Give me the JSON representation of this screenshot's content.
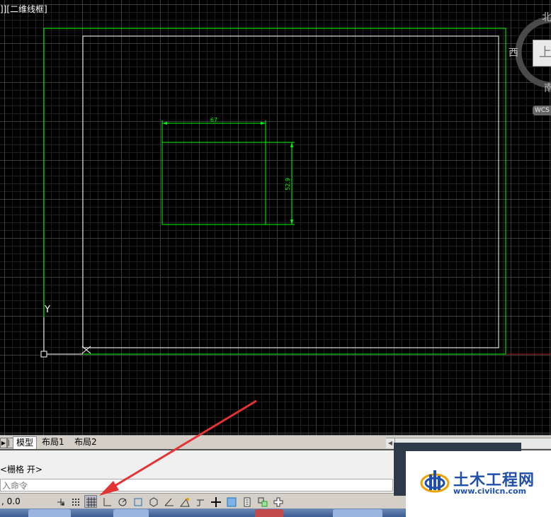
{
  "viewport": {
    "label": "]][二维线框]",
    "dimension_horizontal": "67",
    "dimension_vertical": "52.9",
    "ucs_y": "Y"
  },
  "viewcube": {
    "north": "北",
    "west": "西",
    "south": "南",
    "face": "上",
    "wcs": "WCS"
  },
  "tabs": {
    "model": "模型",
    "layout1": "布局1",
    "layout2": "布局2"
  },
  "command": {
    "history_line": "<栅格 开>",
    "input_placeholder": "入命令"
  },
  "status": {
    "coords": ", 0.0"
  },
  "watermark": {
    "title": "土木工程网",
    "url": "www.civilcn.com"
  },
  "colors": {
    "border_green": "#00ff00",
    "sheet_white": "#ffffff",
    "annotation_arrow": "#e53333"
  }
}
